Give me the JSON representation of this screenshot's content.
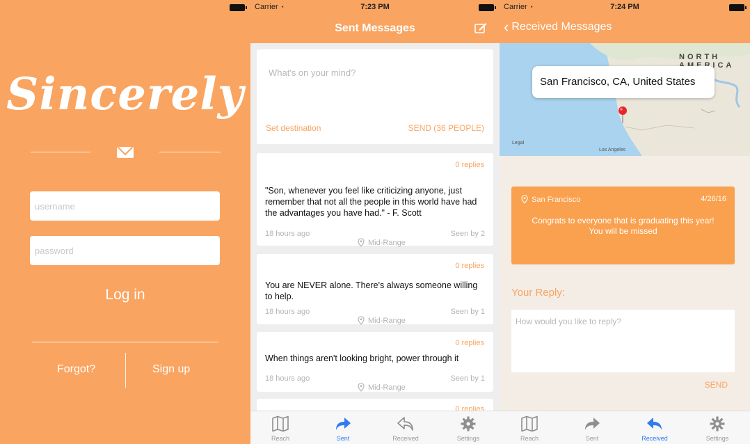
{
  "status": {
    "carrier": "Carrier",
    "time_sent": "7:23 PM",
    "time_received": "7:24 PM"
  },
  "colors": {
    "brand_orange": "#f9a460",
    "card_orange": "#f9a14f",
    "tab_active": "#2f7bf0",
    "tab_inactive": "#9a9a9a"
  },
  "login": {
    "logo": "Sincerely",
    "username_placeholder": "username",
    "password_placeholder": "password",
    "login_label": "Log in",
    "forgot_label": "Forgot?",
    "signup_label": "Sign up"
  },
  "sent": {
    "title": "Sent Messages",
    "compose_placeholder": "What's on your mind?",
    "set_destination": "Set destination",
    "send_label": "SEND (36 PEOPLE)",
    "messages": [
      {
        "replies": "0 replies",
        "text": "\"Son, whenever you feel like criticizing anyone, just remember that not all the people in this world have had the advantages you have had.\" - F. Scott",
        "time": "18 hours ago",
        "location": "Mid-Range",
        "seen": "Seen by 2"
      },
      {
        "replies": "0 replies",
        "text": "You are NEVER alone. There's always someone willing to help.",
        "time": "18 hours ago",
        "location": "Mid-Range",
        "seen": "Seen by 1"
      },
      {
        "replies": "0 replies",
        "text": "When things aren't looking bright, power through it",
        "time": "18 hours ago",
        "location": "Mid-Range",
        "seen": "Seen by 1"
      },
      {
        "replies": "0 replies"
      }
    ]
  },
  "received": {
    "back_label": "Received Messages",
    "map": {
      "callout": "San Francisco, CA, United States",
      "label_north": "NORTH",
      "label_america": "AMERICA",
      "label_los_angeles": "Los Angeles",
      "label_legal": "Legal"
    },
    "message": {
      "location": "San Francisco",
      "date": "4/26/16",
      "text_line1": "Congrats to everyone that is graduating this year!",
      "text_line2": "You will be missed"
    },
    "reply_label": "Your Reply:",
    "reply_placeholder": "How would you like to reply?",
    "send_label": "SEND"
  },
  "tabs": [
    {
      "label": "Reach",
      "icon": "map-icon"
    },
    {
      "label": "Sent",
      "icon": "forward-arrow-icon"
    },
    {
      "label": "Received",
      "icon": "reply-arrow-icon"
    },
    {
      "label": "Settings",
      "icon": "gear-icon"
    }
  ],
  "tab_active": {
    "sent_screen": "Sent",
    "received_screen": "Received"
  }
}
